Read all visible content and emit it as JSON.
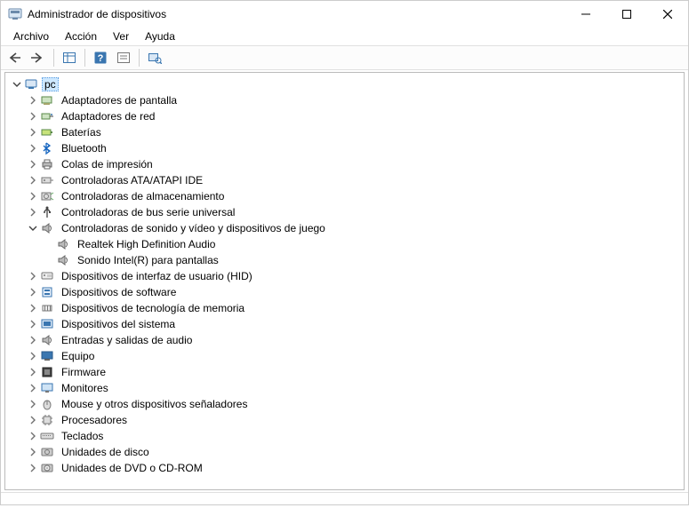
{
  "window": {
    "title": "Administrador de dispositivos"
  },
  "menu": {
    "file": "Archivo",
    "action": "Acción",
    "view": "Ver",
    "help": "Ayuda"
  },
  "tree": {
    "root": "pc",
    "items": [
      {
        "label": "Adaptadores de pantalla",
        "icon": "display-adapter"
      },
      {
        "label": "Adaptadores de red",
        "icon": "network-adapter"
      },
      {
        "label": "Baterías",
        "icon": "battery"
      },
      {
        "label": "Bluetooth",
        "icon": "bluetooth"
      },
      {
        "label": "Colas de impresión",
        "icon": "printer"
      },
      {
        "label": "Controladoras ATA/ATAPI IDE",
        "icon": "ide-controller"
      },
      {
        "label": "Controladoras de almacenamiento",
        "icon": "storage-controller"
      },
      {
        "label": "Controladoras de bus serie universal",
        "icon": "usb-controller"
      },
      {
        "label": "Controladoras de sonido y vídeo y dispositivos de juego",
        "icon": "sound-controller",
        "expanded": true,
        "children": [
          {
            "label": "Realtek High Definition Audio",
            "icon": "sound-device"
          },
          {
            "label": "Sonido Intel(R) para pantallas",
            "icon": "sound-device"
          }
        ]
      },
      {
        "label": "Dispositivos de interfaz de usuario (HID)",
        "icon": "hid"
      },
      {
        "label": "Dispositivos de software",
        "icon": "software-device"
      },
      {
        "label": "Dispositivos de tecnología de memoria",
        "icon": "memory-tech"
      },
      {
        "label": "Dispositivos del sistema",
        "icon": "system-device"
      },
      {
        "label": "Entradas y salidas de audio",
        "icon": "audio-io"
      },
      {
        "label": "Equipo",
        "icon": "computer"
      },
      {
        "label": "Firmware",
        "icon": "firmware"
      },
      {
        "label": "Monitores",
        "icon": "monitor"
      },
      {
        "label": "Mouse y otros dispositivos señaladores",
        "icon": "mouse"
      },
      {
        "label": "Procesadores",
        "icon": "processor"
      },
      {
        "label": "Teclados",
        "icon": "keyboard"
      },
      {
        "label": "Unidades de disco",
        "icon": "disk-drive"
      },
      {
        "label": "Unidades de DVD o CD-ROM",
        "icon": "dvd-drive"
      }
    ]
  }
}
